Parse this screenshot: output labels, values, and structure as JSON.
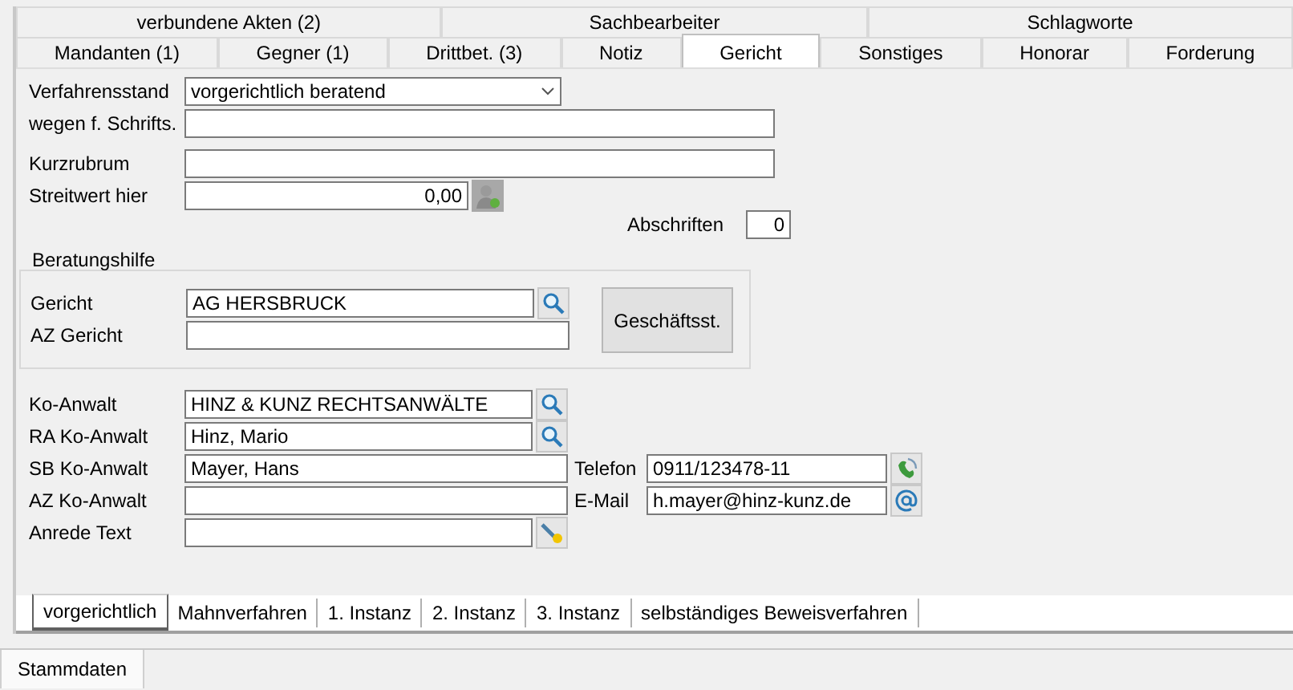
{
  "tab_rows": [
    {
      "tabs": [
        {
          "label": "verbundene Akten (2)",
          "selected": false
        },
        {
          "label": "Sachbearbeiter",
          "selected": false
        },
        {
          "label": "Schlagworte",
          "selected": false
        }
      ]
    },
    {
      "tabs": [
        {
          "label": "Mandanten (1)",
          "selected": false
        },
        {
          "label": "Gegner (1)",
          "selected": false
        },
        {
          "label": "Drittbet. (3)",
          "selected": false
        },
        {
          "label": "Notiz",
          "selected": false
        },
        {
          "label": "Gericht",
          "selected": true
        },
        {
          "label": "Sonstiges",
          "selected": false
        },
        {
          "label": "Honorar",
          "selected": false
        },
        {
          "label": "Forderung",
          "selected": false
        }
      ]
    }
  ],
  "verfahrensstand": {
    "label": "Verfahrensstand",
    "value": "vorgerichtlich beratend"
  },
  "wegen": {
    "label": "wegen f. Schrifts."
  },
  "kurzrubrum": {
    "label": "Kurzrubrum"
  },
  "streitwert": {
    "label": "Streitwert hier",
    "value": "0,00"
  },
  "abschriften": {
    "label": "Abschriften",
    "value": "0"
  },
  "beratungshilfe": {
    "title": "Beratungshilfe",
    "gericht": {
      "label": "Gericht",
      "value": "AG HERSBRUCK"
    },
    "az_gericht": {
      "label": "AZ Gericht"
    },
    "button": "Geschäftsst."
  },
  "contacts": [
    {
      "label": "Ko-Anwalt",
      "value": "HINZ & KUNZ RECHTSANWÄLTE",
      "kind": "lookup"
    },
    {
      "label": "RA Ko-Anwalt",
      "value": "Hinz, Mario",
      "kind": "lookup"
    },
    {
      "label": "SB Ko-Anwalt",
      "value": "Mayer, Hans",
      "kind": "wide",
      "side": {
        "label": "Telefon",
        "value": "0911/123478-11",
        "kind": "phone"
      }
    },
    {
      "label": "AZ Ko-Anwalt",
      "kind": "wide",
      "side": {
        "label": "E-Mail",
        "value": "h.mayer@hinz-kunz.de",
        "kind": "mail"
      }
    },
    {
      "label": "Anrede Text",
      "kind": "key"
    }
  ],
  "bottom_tabs": [
    {
      "label": "vorgerichtlich",
      "selected": true
    },
    {
      "label": "Mahnverfahren",
      "selected": false
    },
    {
      "label": "1. Instanz",
      "selected": false
    },
    {
      "label": "2. Instanz",
      "selected": false
    },
    {
      "label": "3. Instanz",
      "selected": false
    },
    {
      "label": "selbständiges Beweisverfahren",
      "selected": false
    }
  ],
  "footer_tabs": [
    {
      "label": "Stammdaten",
      "selected": true
    }
  ]
}
